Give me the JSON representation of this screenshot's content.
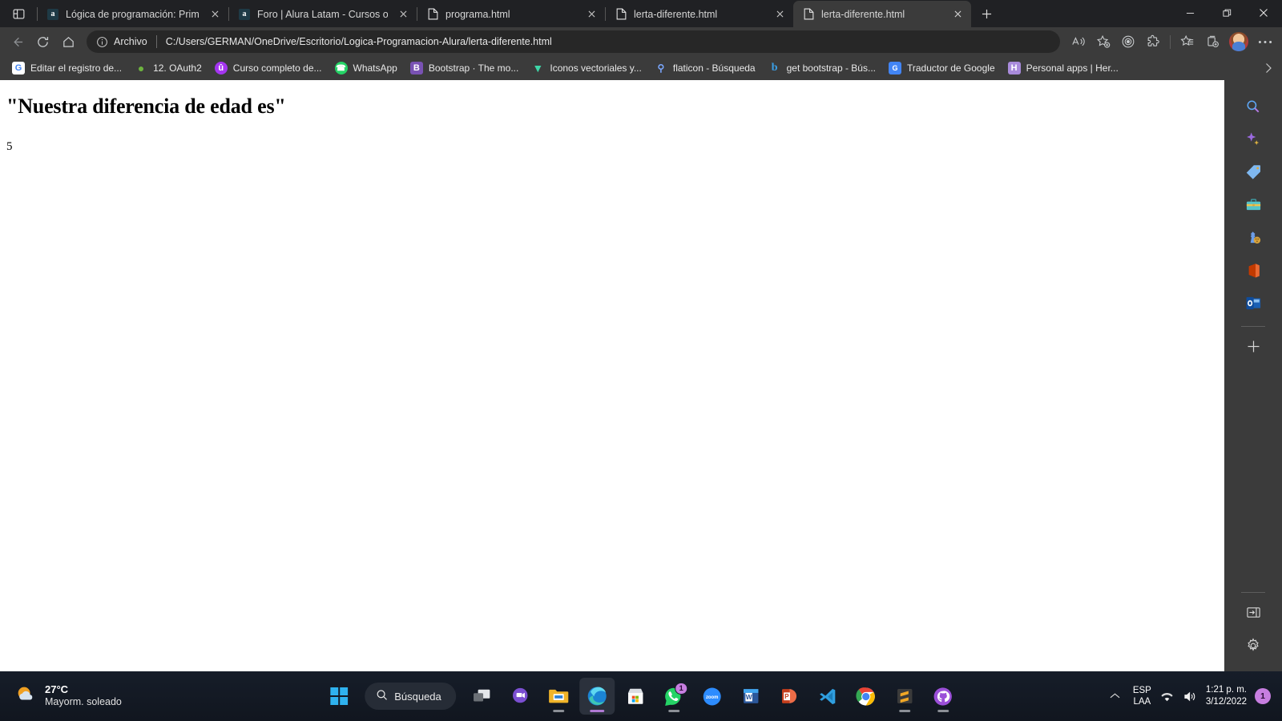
{
  "window": {
    "controls": {
      "minimize": "minimize-icon",
      "restore": "restore-icon",
      "close": "close-icon"
    }
  },
  "tabstrip": {
    "tab_search_label": "tab-search-icon",
    "new_tab_label": "+",
    "tabs": [
      {
        "title": "Lógica de programación: Primer",
        "favicon": "alura-icon",
        "active": false
      },
      {
        "title": "Foro | Alura Latam - Cursos onlin",
        "favicon": "alura-icon",
        "active": false
      },
      {
        "title": "programa.html",
        "favicon": "file-icon",
        "active": false
      },
      {
        "title": "lerta-diferente.html",
        "favicon": "file-icon",
        "active": false
      },
      {
        "title": "lerta-diferente.html",
        "favicon": "file-icon",
        "active": true
      }
    ]
  },
  "toolbar": {
    "back": "back-icon",
    "refresh": "refresh-icon",
    "home": "home-icon",
    "omnibox": {
      "info_icon": "info-icon",
      "scheme_label": "Archivo",
      "url": "C:/Users/GERMAN/OneDrive/Escritorio/Logica-Programacion-Alura/lerta-diferente.html"
    },
    "read_aloud": "read-aloud-icon",
    "add_favorite": "add-favorite-icon",
    "rewards": "rewards-icon",
    "extensions": "extensions-icon",
    "favorites": "favorites-icon",
    "collections": "collections-icon",
    "profile": "avatar",
    "settings_more": "more-icon"
  },
  "bookmarks": {
    "overflow": "chevron-right-icon",
    "items": [
      {
        "label": "Editar el registro de...",
        "icon": "google-icon",
        "glyph": "G",
        "bg": "#ffffff",
        "fg": "#4285f4"
      },
      {
        "label": "12. OAuth2",
        "icon": "spring-icon",
        "glyph": "◖",
        "bg": "transparent",
        "fg": "#6db33f"
      },
      {
        "label": "Curso completo de...",
        "icon": "udemy-icon",
        "glyph": "û",
        "bg": "#a435f0",
        "fg": "#ffffff"
      },
      {
        "label": "WhatsApp",
        "icon": "whatsapp-icon",
        "glyph": "✆",
        "bg": "#25d366",
        "fg": "#ffffff"
      },
      {
        "label": "Bootstrap · The mo...",
        "icon": "bootstrap-icon",
        "glyph": "B",
        "bg": "#7952b3",
        "fg": "#ffffff"
      },
      {
        "label": "Iconos vectoriales y...",
        "icon": "flaticon-icon",
        "glyph": "▽",
        "bg": "transparent",
        "fg": "#3ed6a8"
      },
      {
        "label": "flaticon - Búsqueda",
        "icon": "search-icon",
        "glyph": "⚲",
        "bg": "transparent",
        "fg": "#7aa7ff"
      },
      {
        "label": "get bootstrap - Bús...",
        "icon": "bing-icon",
        "glyph": "b",
        "bg": "transparent",
        "fg": "#3aa0e8"
      },
      {
        "label": "Traductor de Google",
        "icon": "google-translate-icon",
        "glyph": "G",
        "bg": "#4285f4",
        "fg": "#ffffff"
      },
      {
        "label": "Personal apps | Her...",
        "icon": "heroku-icon",
        "glyph": "H",
        "bg": "#a98bdb",
        "fg": "#ffffff"
      }
    ]
  },
  "page_content": {
    "heading": "\"Nuestra diferencia de edad es\"",
    "result": "5"
  },
  "edge_sidebar": {
    "items": [
      {
        "name": "search-icon",
        "glyph": "🔍"
      },
      {
        "name": "copilot-sparkle-icon",
        "glyph": "✦"
      },
      {
        "name": "shopping-tag-icon",
        "glyph": "🏷"
      },
      {
        "name": "tools-briefcase-icon",
        "glyph": "💼"
      },
      {
        "name": "games-icon",
        "glyph": "♟"
      },
      {
        "name": "office-icon",
        "glyph": "◧"
      },
      {
        "name": "outlook-icon",
        "glyph": "▣"
      },
      {
        "name": "add-sidebar-app-icon",
        "glyph": "+"
      }
    ],
    "bottom_items": [
      {
        "name": "sidebar-toggle-icon",
        "glyph": "→"
      },
      {
        "name": "sidebar-settings-gear-icon",
        "glyph": "⚙"
      }
    ]
  },
  "taskbar": {
    "weather": {
      "temperature": "27°C",
      "description": "Mayorm. soleado",
      "icon": "weather-partly-sunny-icon"
    },
    "start": "windows-start-icon",
    "search": {
      "label": "Búsqueda",
      "icon": "search-icon"
    },
    "apps": [
      {
        "name": "task-view-icon",
        "running": false,
        "badge": ""
      },
      {
        "name": "teams-chat-icon",
        "running": false,
        "badge": ""
      },
      {
        "name": "file-explorer-icon",
        "running": true,
        "badge": ""
      },
      {
        "name": "microsoft-edge-icon",
        "running": true,
        "active": true,
        "badge": ""
      },
      {
        "name": "microsoft-store-icon",
        "running": false,
        "badge": ""
      },
      {
        "name": "whatsapp-icon",
        "running": true,
        "badge": "1"
      },
      {
        "name": "zoom-icon",
        "running": false,
        "badge": ""
      },
      {
        "name": "word-icon",
        "running": false,
        "badge": ""
      },
      {
        "name": "powerpoint-icon",
        "running": false,
        "badge": ""
      },
      {
        "name": "vscode-icon",
        "running": false,
        "badge": ""
      },
      {
        "name": "chrome-icon",
        "running": false,
        "badge": ""
      },
      {
        "name": "sublime-text-icon",
        "running": true,
        "badge": ""
      },
      {
        "name": "github-desktop-icon",
        "running": true,
        "badge": ""
      }
    ],
    "tray": {
      "chevron": "show-hidden-icons-icon",
      "lang_line1": "ESP",
      "lang_line2": "LAA",
      "wifi": "wifi-icon",
      "volume": "volume-icon",
      "time": "1:21 p. m.",
      "date": "3/12/2022",
      "notification_count": "1"
    }
  },
  "colors": {
    "chrome_bg": "#202124",
    "toolbar_bg": "#3b3b3b",
    "omnibox_bg": "#272727",
    "page_bg": "#ffffff",
    "taskbar_bg": "#161d29",
    "accent_purple": "#c77ee0"
  }
}
